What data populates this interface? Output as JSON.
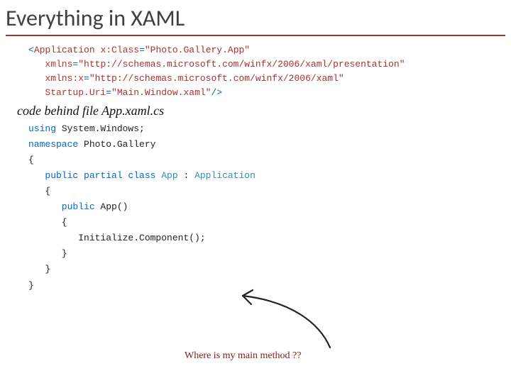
{
  "title": "Everything in XAML",
  "xaml": {
    "open": "<",
    "elem": "Application",
    "attr1_name": " x:Class",
    "attr1_eq": "=",
    "attr1_val": "\"Photo.Gallery.App\"",
    "attr2_name": "xmlns",
    "attr2_eq": "=",
    "attr2_val": "\"http://schemas.microsoft.com/winfx/2006/xaml/presentation\"",
    "attr3_name": "xmlns:x",
    "attr3_eq": "=",
    "attr3_val": "\"http://schemas.microsoft.com/winfx/2006/xaml\"",
    "attr4_name": "Startup.Uri",
    "attr4_eq": "=",
    "attr4_val": "\"Main.Window.xaml\"",
    "close": "/>"
  },
  "handwrite": "code behind file App.xaml.cs",
  "cs": {
    "l1_using": "using",
    "l1_ns": " System.Windows",
    "l1_semi": ";",
    "l2_nskw": "namespace",
    "l2_nsname": " Photo.Gallery",
    "l3_brace": "{",
    "l4_mods": "   public partial class",
    "l4_name": " App",
    "l4_colon": " : ",
    "l4_base": "Application",
    "l5_brace": "   {",
    "l6_mods": "      public",
    "l6_ctor": " App()",
    "l7_brace": "      {",
    "l8_call": "         Initialize.Component();",
    "l9_brace": "      }",
    "l10_brace": "   }",
    "l11_brace": "}"
  },
  "annotation": "Where is my main method ??"
}
